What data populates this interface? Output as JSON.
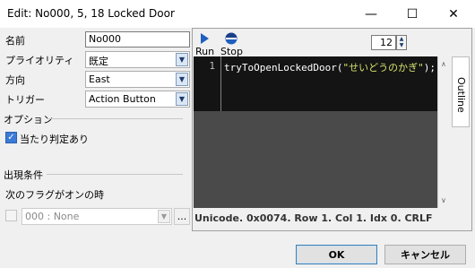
{
  "window": {
    "title": "Edit: No000, 5, 18 Locked Door"
  },
  "controls": {
    "minimize": "—",
    "maximize": "☐",
    "close": "✕"
  },
  "form": {
    "name_label": "名前",
    "name_value": "No000",
    "priority_label": "プライオリティ",
    "priority_value": "既定",
    "direction_label": "方向",
    "direction_value": "East",
    "trigger_label": "トリガー",
    "trigger_value": "Action Button",
    "options_label": "オプション",
    "hit_check_label": "当たり判定あり",
    "hit_check_checked": true,
    "condition_label": "出現条件",
    "flag_label": "次のフラグがオンの時",
    "flag_value": "000 : None",
    "flag_browse": "..."
  },
  "editor": {
    "run_label": "Run",
    "stop_label": "Stop",
    "font_size": "12",
    "line_number": "1",
    "code_func": "tryToOpenLockedDoor(",
    "code_string": "\"せいどうのかぎ\"",
    "code_end": ");",
    "outline_label": "Outline",
    "status": "Unicode. 0x0074. Row 1. Col 1. Idx 0. CRLF"
  },
  "buttons": {
    "ok": "OK",
    "cancel": "キャンセル"
  }
}
